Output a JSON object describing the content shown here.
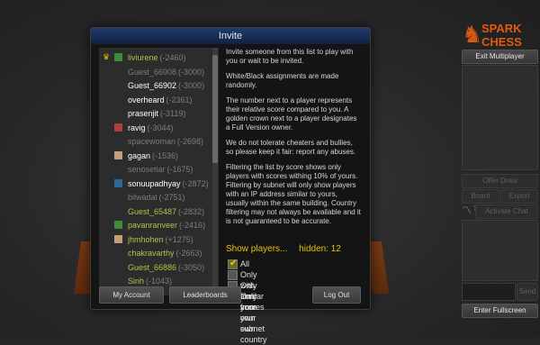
{
  "dialog": {
    "title": "Invite",
    "players": [
      {
        "name": "liviurene",
        "score": "(-2460)",
        "color": "#a8c84a",
        "icon": "crown-icon",
        "flag": "flag-icon"
      },
      {
        "name": "Guest_66908",
        "score": "(-3000)",
        "color": "#7a7a7a",
        "icon": "",
        "flag": ""
      },
      {
        "name": "Guest_66902",
        "score": "(-3000)",
        "color": "#ffffff",
        "icon": "",
        "flag": ""
      },
      {
        "name": "overheard",
        "score": "(-2361)",
        "color": "#ffffff",
        "icon": "",
        "flag": ""
      },
      {
        "name": "prasenjit",
        "score": "(-3119)",
        "color": "#ffffff",
        "icon": "",
        "flag": ""
      },
      {
        "name": "ravig",
        "score": "(-3044)",
        "color": "#ffffff",
        "icon": "",
        "flag": "flag-icon"
      },
      {
        "name": "spacewoman",
        "score": "(-2698)",
        "color": "#7a7a7a",
        "icon": "",
        "flag": ""
      },
      {
        "name": "gagan",
        "score": "(-1536)",
        "color": "#ffffff",
        "icon": "",
        "flag": "flag-icon"
      },
      {
        "name": "senosetiar",
        "score": "(-1675)",
        "color": "#7a7a7a",
        "icon": "",
        "flag": ""
      },
      {
        "name": "sonuupadhyay",
        "score": "(-2872)",
        "color": "#ffffff",
        "icon": "",
        "flag": "flag-icon"
      },
      {
        "name": "bilwadal",
        "score": "(-2751)",
        "color": "#7a7a7a",
        "icon": "",
        "flag": ""
      },
      {
        "name": "Guest_65487",
        "score": "(-2832)",
        "color": "#a8c84a",
        "icon": "",
        "flag": ""
      },
      {
        "name": "pavanranveer",
        "score": "(-2416)",
        "color": "#a8c84a",
        "icon": "",
        "flag": "flag-icon"
      },
      {
        "name": "jhmhohen",
        "score": "(+1275)",
        "color": "#a8c84a",
        "icon": "",
        "flag": "flag-icon"
      },
      {
        "name": "chakravarthy",
        "score": "(-2663)",
        "color": "#a8c84a",
        "icon": "",
        "flag": ""
      },
      {
        "name": "Guest_66886",
        "score": "(-3050)",
        "color": "#a8c84a",
        "icon": "",
        "flag": ""
      },
      {
        "name": "Sinh",
        "score": "(-1043)",
        "color": "#a8c84a",
        "icon": "",
        "flag": ""
      }
    ],
    "info": [
      "Invite someone from this list to play with you or wait to be invited.",
      "White/Black assignments are made randomly.",
      "The number next to a player represents their relative score compared to you. A golden crown next to a player designates a Full Version owner.",
      "We do not tolerate cheaters and bullies, so please keep it fair: report any abuses.",
      "Filtering the list by score shows only players with scores withing 10% of yours. Filtering by subnet will only show players with an IP address similar to yours, usually within the same building. Country filtering may not always be available and it is not guaranteed to be accurate."
    ],
    "show_players_label": "Show players...",
    "hidden_label": "hidden: 12",
    "filters": [
      {
        "label": "All",
        "checked": true
      },
      {
        "label": "Only with similar scores",
        "checked": false
      },
      {
        "label": "Only from your own subnet",
        "checked": false
      },
      {
        "label": "Only from your own country",
        "checked": false
      }
    ],
    "my_account_label": "My Account",
    "leaderboards_label": "Leaderboards",
    "logout_label": "Log Out"
  },
  "sidebar": {
    "logo_line1": "SPARK",
    "logo_line2": "CHESS",
    "exit_label": "Exit Multiplayer",
    "offer_draw_label": "Offer Draw",
    "board_type_label": "Board Type",
    "export_pgn_label": "Export PGN",
    "activate_chat_label": "Activate Chat",
    "send_label": "Send",
    "fullscreen_label": "Enter Fullscreen"
  }
}
